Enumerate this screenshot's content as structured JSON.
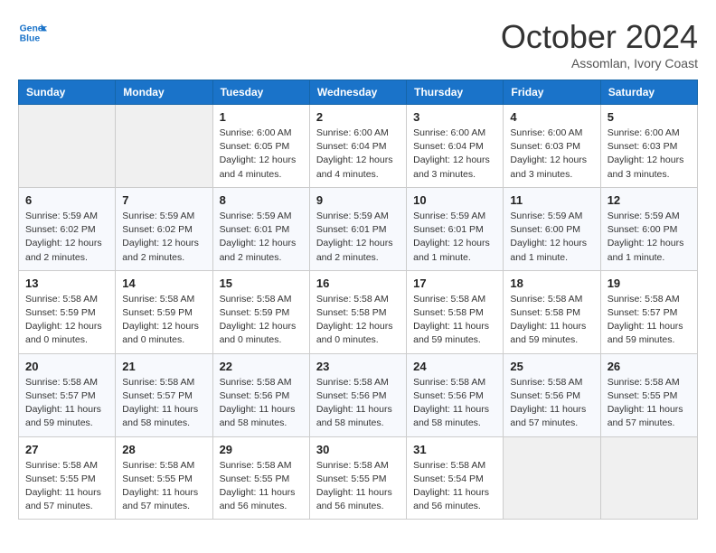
{
  "header": {
    "logo_line1": "General",
    "logo_line2": "Blue",
    "month": "October 2024",
    "location": "Assomlan, Ivory Coast"
  },
  "weekdays": [
    "Sunday",
    "Monday",
    "Tuesday",
    "Wednesday",
    "Thursday",
    "Friday",
    "Saturday"
  ],
  "weeks": [
    [
      {
        "day": "",
        "info": ""
      },
      {
        "day": "",
        "info": ""
      },
      {
        "day": "1",
        "info": "Sunrise: 6:00 AM\nSunset: 6:05 PM\nDaylight: 12 hours and 4 minutes."
      },
      {
        "day": "2",
        "info": "Sunrise: 6:00 AM\nSunset: 6:04 PM\nDaylight: 12 hours and 4 minutes."
      },
      {
        "day": "3",
        "info": "Sunrise: 6:00 AM\nSunset: 6:04 PM\nDaylight: 12 hours and 3 minutes."
      },
      {
        "day": "4",
        "info": "Sunrise: 6:00 AM\nSunset: 6:03 PM\nDaylight: 12 hours and 3 minutes."
      },
      {
        "day": "5",
        "info": "Sunrise: 6:00 AM\nSunset: 6:03 PM\nDaylight: 12 hours and 3 minutes."
      }
    ],
    [
      {
        "day": "6",
        "info": "Sunrise: 5:59 AM\nSunset: 6:02 PM\nDaylight: 12 hours and 2 minutes."
      },
      {
        "day": "7",
        "info": "Sunrise: 5:59 AM\nSunset: 6:02 PM\nDaylight: 12 hours and 2 minutes."
      },
      {
        "day": "8",
        "info": "Sunrise: 5:59 AM\nSunset: 6:01 PM\nDaylight: 12 hours and 2 minutes."
      },
      {
        "day": "9",
        "info": "Sunrise: 5:59 AM\nSunset: 6:01 PM\nDaylight: 12 hours and 2 minutes."
      },
      {
        "day": "10",
        "info": "Sunrise: 5:59 AM\nSunset: 6:01 PM\nDaylight: 12 hours and 1 minute."
      },
      {
        "day": "11",
        "info": "Sunrise: 5:59 AM\nSunset: 6:00 PM\nDaylight: 12 hours and 1 minute."
      },
      {
        "day": "12",
        "info": "Sunrise: 5:59 AM\nSunset: 6:00 PM\nDaylight: 12 hours and 1 minute."
      }
    ],
    [
      {
        "day": "13",
        "info": "Sunrise: 5:58 AM\nSunset: 5:59 PM\nDaylight: 12 hours and 0 minutes."
      },
      {
        "day": "14",
        "info": "Sunrise: 5:58 AM\nSunset: 5:59 PM\nDaylight: 12 hours and 0 minutes."
      },
      {
        "day": "15",
        "info": "Sunrise: 5:58 AM\nSunset: 5:59 PM\nDaylight: 12 hours and 0 minutes."
      },
      {
        "day": "16",
        "info": "Sunrise: 5:58 AM\nSunset: 5:58 PM\nDaylight: 12 hours and 0 minutes."
      },
      {
        "day": "17",
        "info": "Sunrise: 5:58 AM\nSunset: 5:58 PM\nDaylight: 11 hours and 59 minutes."
      },
      {
        "day": "18",
        "info": "Sunrise: 5:58 AM\nSunset: 5:58 PM\nDaylight: 11 hours and 59 minutes."
      },
      {
        "day": "19",
        "info": "Sunrise: 5:58 AM\nSunset: 5:57 PM\nDaylight: 11 hours and 59 minutes."
      }
    ],
    [
      {
        "day": "20",
        "info": "Sunrise: 5:58 AM\nSunset: 5:57 PM\nDaylight: 11 hours and 59 minutes."
      },
      {
        "day": "21",
        "info": "Sunrise: 5:58 AM\nSunset: 5:57 PM\nDaylight: 11 hours and 58 minutes."
      },
      {
        "day": "22",
        "info": "Sunrise: 5:58 AM\nSunset: 5:56 PM\nDaylight: 11 hours and 58 minutes."
      },
      {
        "day": "23",
        "info": "Sunrise: 5:58 AM\nSunset: 5:56 PM\nDaylight: 11 hours and 58 minutes."
      },
      {
        "day": "24",
        "info": "Sunrise: 5:58 AM\nSunset: 5:56 PM\nDaylight: 11 hours and 58 minutes."
      },
      {
        "day": "25",
        "info": "Sunrise: 5:58 AM\nSunset: 5:56 PM\nDaylight: 11 hours and 57 minutes."
      },
      {
        "day": "26",
        "info": "Sunrise: 5:58 AM\nSunset: 5:55 PM\nDaylight: 11 hours and 57 minutes."
      }
    ],
    [
      {
        "day": "27",
        "info": "Sunrise: 5:58 AM\nSunset: 5:55 PM\nDaylight: 11 hours and 57 minutes."
      },
      {
        "day": "28",
        "info": "Sunrise: 5:58 AM\nSunset: 5:55 PM\nDaylight: 11 hours and 57 minutes."
      },
      {
        "day": "29",
        "info": "Sunrise: 5:58 AM\nSunset: 5:55 PM\nDaylight: 11 hours and 56 minutes."
      },
      {
        "day": "30",
        "info": "Sunrise: 5:58 AM\nSunset: 5:55 PM\nDaylight: 11 hours and 56 minutes."
      },
      {
        "day": "31",
        "info": "Sunrise: 5:58 AM\nSunset: 5:54 PM\nDaylight: 11 hours and 56 minutes."
      },
      {
        "day": "",
        "info": ""
      },
      {
        "day": "",
        "info": ""
      }
    ]
  ]
}
